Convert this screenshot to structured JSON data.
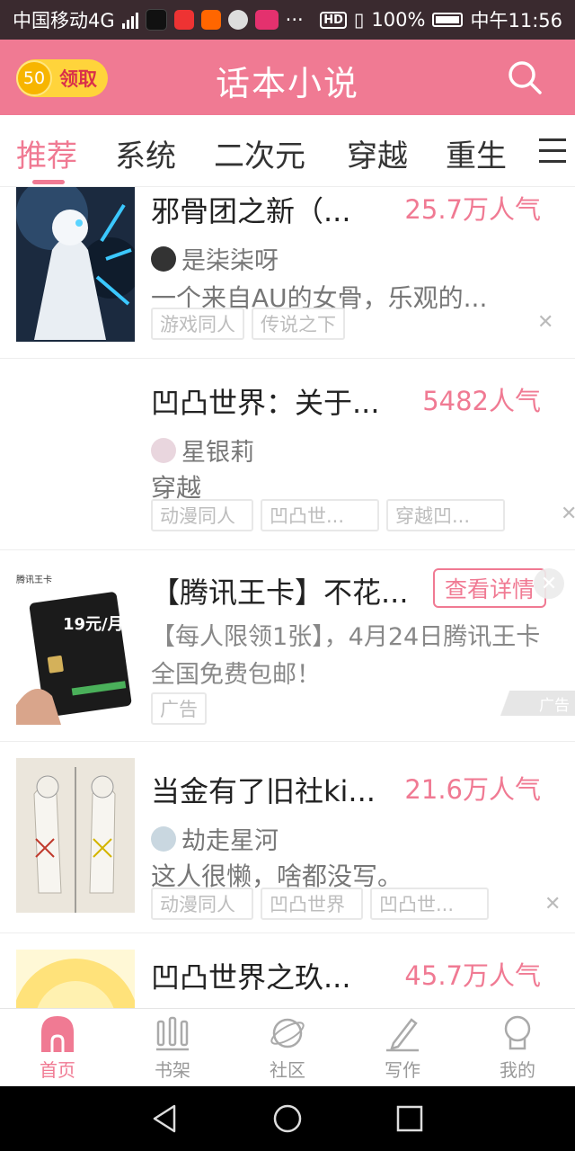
{
  "status_bar": {
    "carrier": "中国移动4G",
    "battery": "100%",
    "time": "中午11:56",
    "hd": "HD"
  },
  "header": {
    "coin_value": "50",
    "coin_label": "领取",
    "title": "话本小说",
    "search_icon": "search-icon"
  },
  "tabs": [
    "推荐",
    "系统",
    "二次元",
    "穿越",
    "重生"
  ],
  "active_tab": "推荐",
  "feed": {
    "items": [
      {
        "title": "邪骨团之新（...",
        "popularity": "25.7万人气",
        "author": "是柒柒呀",
        "desc": "一个来自AU的女骨，乐观的...",
        "tags": [
          "游戏同人",
          "传说之下"
        ]
      },
      {
        "title": "凹凸世界：关于...",
        "popularity": "5482人气",
        "author": "星银莉",
        "desc": "穿越",
        "tags": [
          "动漫同人",
          "凹凸世...",
          "穿越凹..."
        ]
      },
      {
        "title": "当金有了旧社ki...",
        "popularity": "21.6万人气",
        "author": "劫走星河",
        "desc": "这人很懒，啥都没写。",
        "tags": [
          "动漫同人",
          "凹凸世界",
          "凹凸世..."
        ]
      },
      {
        "title": "凹凸世界之玖...",
        "popularity": "45.7万人气"
      }
    ],
    "ad": {
      "title": "【腾讯王卡】不花...",
      "button": "查看详情",
      "desc": "【每人限领1张】，4月24日腾讯王卡全国免费包邮！",
      "tag": "广告",
      "mark": "广告",
      "card_brand": "腾讯王卡",
      "card_price": "19元/月"
    }
  },
  "bottom_nav": [
    "首页",
    "书架",
    "社区",
    "写作",
    "我的"
  ],
  "colors": {
    "accent": "#f07a93",
    "status_bar": "#3a2a2f",
    "coin": "#ffd43b"
  }
}
